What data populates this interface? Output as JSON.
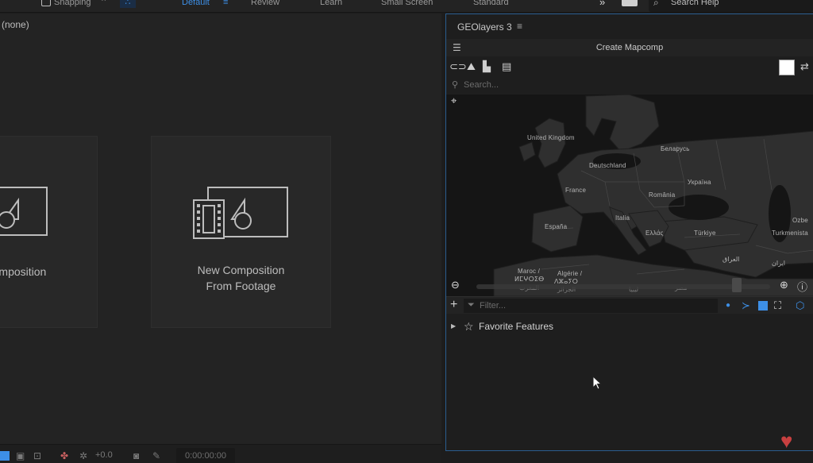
{
  "topbar": {
    "snapping_label": "Snapping",
    "workspaces": [
      "Default",
      "Review",
      "Learn",
      "Small Screen",
      "Standard"
    ],
    "active_workspace": "Default",
    "overflow_glyph": "»",
    "search_placeholder": "Search Help"
  },
  "composition_panel": {
    "header_label": "(none)",
    "cards": [
      {
        "label_line1": "omposition",
        "label_line2": "",
        "icon": "composition-icon"
      },
      {
        "label_line1": "New Composition",
        "label_line2": "From Footage",
        "icon": "composition-from-footage-icon"
      }
    ],
    "bottom_bar": {
      "exposure_value": "+0.0",
      "timecode": "0:00:00:00"
    }
  },
  "geolayers_panel": {
    "title": "GEOlayers 3",
    "create_button_label": "Create Mapcomp",
    "search_placeholder": "Search...",
    "filter_placeholder": "Filter...",
    "swatch_color": "#ffffff",
    "accent_color": "#3d8fe6",
    "map_labels": [
      "United Kingdom",
      "Беларусь",
      "Deutschland",
      "France",
      "Україна",
      "România",
      "Italia",
      "España",
      "Ελλάς",
      "Türkiye",
      "Ozbe",
      "Turkmenista",
      "العراق",
      "ایران",
      "Maroc /",
      "ⵍⵎⵖⵔⵉⴱ",
      "Algérie /",
      "ⴷⵣⴰⵢⵔ",
      "المغرب",
      "الجزائر",
      "ليبيا",
      "مصر"
    ],
    "tree": [
      {
        "label": "Favorite Features",
        "icon": "star-icon",
        "expanded": false
      }
    ]
  }
}
